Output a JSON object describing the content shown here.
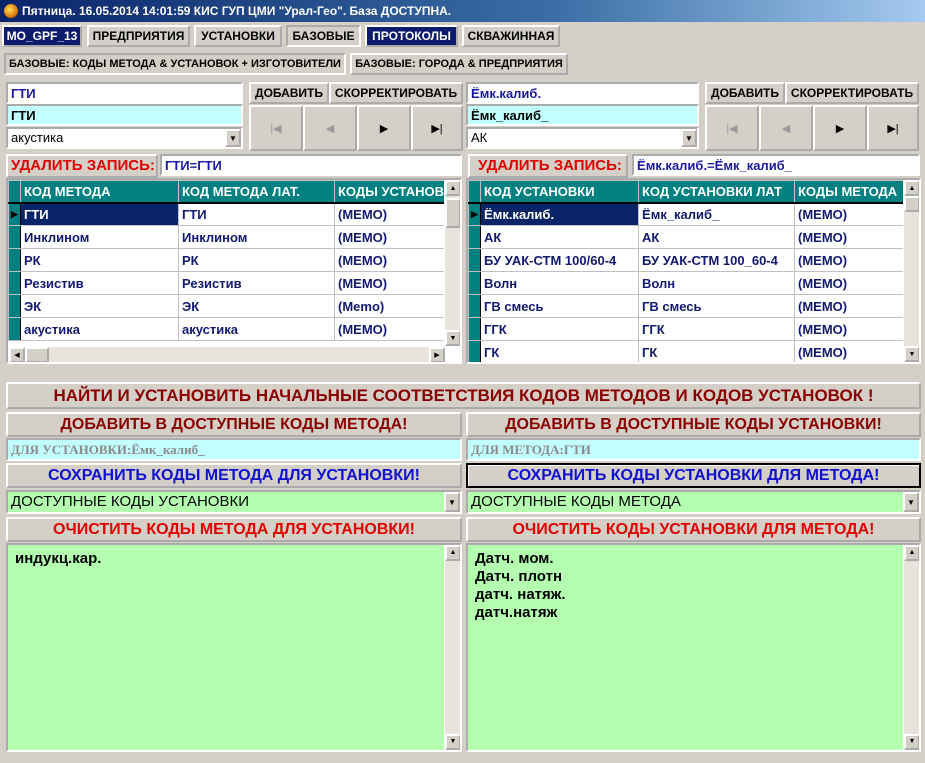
{
  "window": {
    "title": "Пятница. 16.05.2014 14:01:59  КИС ГУП ЦМИ \"Урал-Гео\". База ДОСТУПНА."
  },
  "main_tabs": [
    {
      "label": "MO_GPF_13"
    },
    {
      "label": "ПРЕДПРИЯТИЯ"
    },
    {
      "label": "УСТАНОВКИ"
    },
    {
      "label": "БАЗОВЫЕ"
    },
    {
      "label": "ПРОТОКОЛЫ"
    },
    {
      "label": "СКВАЖИННАЯ"
    }
  ],
  "sub_tabs": [
    {
      "label": "БАЗОВЫЕ: КОДЫ МЕТОДА & УСТАНОВОК + ИЗГОТОВИТЕЛИ"
    },
    {
      "label": "БАЗОВЫЕ: ГОРОДА & ПРЕДПРИЯТИЯ"
    }
  ],
  "left": {
    "field1": "ГТИ",
    "field2": "ГТИ",
    "combo": "акустика",
    "add_label": "ДОБАВИТЬ",
    "edit_label": "СКОРРЕКТИРОВАТЬ",
    "delete_label": "УДАЛИТЬ ЗАПИСЬ:",
    "delete_value": "ГТИ=ГТИ",
    "grid": {
      "columns": [
        "КОД МЕТОДА",
        "КОД МЕТОДА ЛАТ.",
        "КОДЫ УСТАНОВ"
      ],
      "rows": [
        [
          "ГТИ",
          "ГТИ",
          "(МЕМО)"
        ],
        [
          "Инклином",
          "Инклином",
          "(МЕМО)"
        ],
        [
          "РК",
          "РК",
          "(МЕМО)"
        ],
        [
          "Резистив",
          "Резистив",
          "(МЕМО)"
        ],
        [
          "ЭК",
          "ЭК",
          "(Memo)"
        ],
        [
          "акустика",
          "акустика",
          "(МЕМО)"
        ]
      ]
    }
  },
  "right": {
    "field1": "Ёмк.калиб.",
    "field2": "Ёмк_калиб_",
    "combo": "АК",
    "add_label": "ДОБАВИТЬ",
    "edit_label": "СКОРРЕКТИРОВАТЬ",
    "delete_label": "УДАЛИТЬ ЗАПИСЬ:",
    "delete_value": "Ёмк.калиб.=Ёмк_калиб_",
    "grid": {
      "columns": [
        "КОД УСТАНОВКИ",
        "КОД УСТАНОВКИ ЛАТ",
        "КОДЫ МЕТОДА"
      ],
      "rows": [
        [
          "Ёмк.калиб.",
          "Ёмк_калиб_",
          "(МЕМО)"
        ],
        [
          "АК",
          "АК",
          "(МЕМО)"
        ],
        [
          "БУ УАК-СТМ 100/60-4",
          "БУ УАК-СТМ 100_60-4",
          "(МЕМО)"
        ],
        [
          "Волн",
          "Волн",
          "(МЕМО)"
        ],
        [
          "ГВ смесь",
          "ГВ смесь",
          "(МЕМО)"
        ],
        [
          "ГГК",
          "ГГК",
          "(МЕМО)"
        ],
        [
          "ГК",
          "ГК",
          "(МЕМО)"
        ]
      ]
    }
  },
  "find_button": "НАЙТИ И УСТАНОВИТЬ НАЧАЛЬНЫЕ СООТВЕТСТВИЯ КОДОВ МЕТОДОВ И КОДОВ УСТАНОВОК !",
  "bottom_left": {
    "add_button": "ДОБАВИТЬ В ДОСТУПНЫЕ КОДЫ МЕТОДА!",
    "for_field": "ДЛЯ УСТАНОВКИ:Ёмк_калиб_",
    "save_button": "СОХРАНИТЬ КОДЫ МЕТОДА ДЛЯ УСТАНОВКИ!",
    "combo": "ДОСТУПНЫЕ КОДЫ УСТАНОВКИ",
    "clear_button": "ОЧИСТИТЬ КОДЫ МЕТОДА ДЛЯ УСТАНОВКИ!",
    "memo_lines": [
      "индукц.кар."
    ]
  },
  "bottom_right": {
    "add_button": "ДОБАВИТЬ В ДОСТУПНЫЕ КОДЫ УСТАНОВКИ!",
    "for_field": "ДЛЯ МЕТОДА:ГТИ",
    "save_button": "СОХРАНИТЬ КОДЫ УСТАНОВКИ ДЛЯ МЕТОДА!",
    "combo": "ДОСТУПНЫЕ КОДЫ МЕТОДА",
    "clear_button": "ОЧИСТИТЬ КОДЫ УСТАНОВКИ ДЛЯ МЕТОДА!",
    "memo_lines": [
      "Датч. мом.",
      "Датч. плотн",
      "датч. натяж.",
      "датч.натяж"
    ]
  },
  "icons": {
    "nav_first": "first-record-icon",
    "nav_prev": "prev-record-icon",
    "nav_next": "next-record-icon",
    "nav_last": "last-record-icon",
    "dropdown": "chevron-down-icon"
  },
  "colors": {
    "grid_header": "#008080",
    "selected_row": "#0a246a",
    "cyan_field": "#c2ffff",
    "green_field": "#b4ffb0",
    "alert_red": "#e00000"
  }
}
